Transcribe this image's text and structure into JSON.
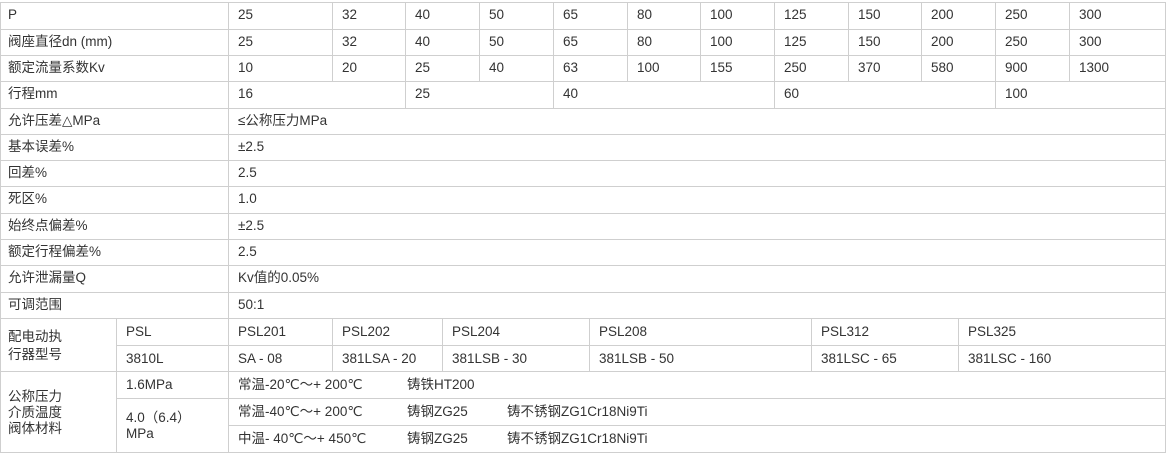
{
  "table": {
    "rows": [
      {
        "label": "P",
        "cells": [
          "25",
          "32",
          "40",
          "50",
          "65",
          "80",
          "100",
          "125",
          "150",
          "200",
          "250",
          "300"
        ]
      },
      {
        "label": "阀座直径dn (mm)",
        "cells": [
          "25",
          "32",
          "40",
          "50",
          "65",
          "80",
          "100",
          "125",
          "150",
          "200",
          "250",
          "300"
        ]
      },
      {
        "label": "额定流量系数Kv",
        "cells": [
          "10",
          "20",
          "25",
          "40",
          "63",
          "100",
          "155",
          "250",
          "370",
          "580",
          "900",
          "1300"
        ]
      },
      {
        "label": "行程mm",
        "cells": [
          "16",
          "25",
          "40",
          "60",
          "100"
        ]
      },
      {
        "label": "允许压差△MPa",
        "value": "≤公称压力MPa"
      },
      {
        "label": "基本误差%",
        "value": "±2.5"
      },
      {
        "label": "回差%",
        "value": "2.5"
      },
      {
        "label": "死区%",
        "value": "1.0"
      },
      {
        "label": "始终点偏差%",
        "value": "±2.5"
      },
      {
        "label": "额定行程偏差%",
        "value": "2.5"
      },
      {
        "label": "允许泄漏量Q",
        "value": "Kv值的0.05%"
      },
      {
        "label": "可调范围",
        "value": "50:1"
      }
    ],
    "actuator": {
      "label_line1": "配电动执",
      "label_line2": "行器型号",
      "row1": [
        "PSL",
        "PSL201",
        "PSL202",
        "PSL204",
        "PSL208",
        "PSL312",
        "PSL325"
      ],
      "row2": [
        "3810L",
        "SA - 08",
        "381LSA - 20",
        "381LSB - 30",
        "381LSB - 50",
        "381LSC - 65",
        "381LSC - 160"
      ]
    },
    "pressure": {
      "label_line1": "公称压力",
      "label_line2": "介质温度",
      "label_line3": "阀体材料",
      "p1": "1.6MPa",
      "p2_line1": "4.0（6.4）",
      "p2_line2": "MPa",
      "r1": [
        "常温-20℃～+ 200℃",
        "铸铁HT200"
      ],
      "r2": [
        "常温-40℃～+ 200℃",
        "铸钢ZG25",
        "铸不锈钢ZG1Cr18Ni9Ti"
      ],
      "r3": [
        "中温- 40℃～+ 450℃",
        "铸钢ZG25",
        "铸不锈钢ZG1Cr18Ni9Ti"
      ]
    }
  }
}
